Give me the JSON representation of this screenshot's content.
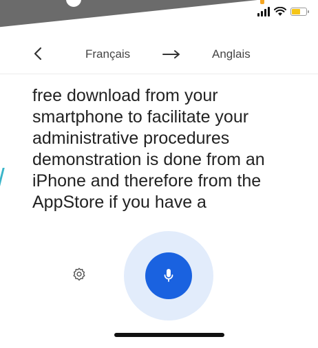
{
  "header": {
    "source_language": "Français",
    "target_language": "Anglais"
  },
  "transcript": {
    "lines": [
      "free download from your",
      "smartphone to facilitate your",
      "administrative procedures",
      "demonstration is done from an",
      "iPhone and therefore from the",
      "AppStore if you have a"
    ]
  },
  "colors": {
    "mic_button": "#1a62e0",
    "mic_halo": "#e2ecfb",
    "battery": "#f5c518",
    "banner": "#6b6b6b"
  },
  "icons": {
    "back": "chevron-left-icon",
    "swap": "arrow-right-icon",
    "settings": "gear-icon",
    "mic": "microphone-icon"
  }
}
